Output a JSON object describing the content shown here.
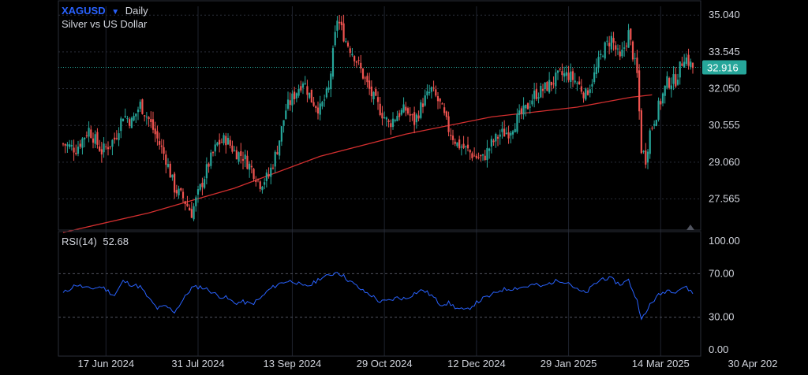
{
  "header": {
    "symbol": "XAGUSD",
    "symbol_dropdown_icon": "caret-down-icon",
    "interval": "Daily",
    "description": "Silver vs US Dollar"
  },
  "price_pane": {
    "y_ticks": [
      "35.040",
      "33.545",
      "32.050",
      "30.555",
      "29.060",
      "27.565"
    ],
    "last_price": "32.916",
    "colors": {
      "up": "#26a69a",
      "down": "#ef5350",
      "ma": "#d32f2f",
      "last_line": "#26a69a",
      "grid": "#2a2e39"
    }
  },
  "rsi_pane": {
    "label": "RSI(14)",
    "value": "52.68",
    "y_ticks": [
      "100.00",
      "70.00",
      "30.00",
      "0.00"
    ],
    "color": "#2962ff"
  },
  "x_axis": {
    "labels": [
      "17 Jun 2024",
      "31 Jul 2024",
      "13 Sep 2024",
      "29 Oct 2024",
      "12 Dec 2024",
      "29 Jan 2025",
      "14 Mar 2025",
      "30 Apr 202"
    ]
  },
  "chart_data": {
    "type": "candlestick",
    "symbol": "XAGUSD",
    "interval": "Daily",
    "y_range": [
      26.3,
      35.4
    ],
    "ma_series": [
      [
        0,
        26.2
      ],
      [
        40,
        27.0
      ],
      [
        80,
        28.0
      ],
      [
        120,
        29.3
      ],
      [
        160,
        30.2
      ],
      [
        200,
        30.9
      ],
      [
        240,
        31.3
      ],
      [
        265,
        31.7
      ],
      [
        275,
        31.8
      ]
    ],
    "close_series": [
      [
        0,
        29.8
      ],
      [
        6,
        29.6
      ],
      [
        12,
        30.4
      ],
      [
        18,
        29.5
      ],
      [
        24,
        30.0
      ],
      [
        28,
        31.0
      ],
      [
        32,
        30.7
      ],
      [
        36,
        31.4
      ],
      [
        40,
        30.8
      ],
      [
        44,
        30.0
      ],
      [
        48,
        29.2
      ],
      [
        52,
        28.0
      ],
      [
        56,
        27.6
      ],
      [
        60,
        27.0
      ],
      [
        64,
        28.0
      ],
      [
        68,
        29.0
      ],
      [
        72,
        29.8
      ],
      [
        76,
        30.0
      ],
      [
        80,
        29.5
      ],
      [
        84,
        29.3
      ],
      [
        88,
        28.8
      ],
      [
        92,
        28.2
      ],
      [
        96,
        28.5
      ],
      [
        100,
        29.6
      ],
      [
        104,
        31.2
      ],
      [
        108,
        31.8
      ],
      [
        112,
        32.4
      ],
      [
        116,
        31.6
      ],
      [
        120,
        31.2
      ],
      [
        124,
        32.0
      ],
      [
        128,
        34.9
      ],
      [
        132,
        34.0
      ],
      [
        136,
        33.4
      ],
      [
        140,
        32.6
      ],
      [
        144,
        31.8
      ],
      [
        148,
        31.2
      ],
      [
        152,
        30.6
      ],
      [
        156,
        31.0
      ],
      [
        160,
        31.2
      ],
      [
        164,
        30.7
      ],
      [
        168,
        31.5
      ],
      [
        172,
        32.0
      ],
      [
        176,
        31.4
      ],
      [
        180,
        30.4
      ],
      [
        184,
        29.8
      ],
      [
        188,
        29.6
      ],
      [
        192,
        29.3
      ],
      [
        196,
        29.2
      ],
      [
        200,
        29.8
      ],
      [
        204,
        30.2
      ],
      [
        208,
        30.3
      ],
      [
        212,
        30.8
      ],
      [
        216,
        31.2
      ],
      [
        220,
        31.8
      ],
      [
        224,
        32.0
      ],
      [
        228,
        32.3
      ],
      [
        232,
        32.6
      ],
      [
        236,
        32.6
      ],
      [
        240,
        32.3
      ],
      [
        244,
        31.8
      ],
      [
        248,
        32.6
      ],
      [
        252,
        33.6
      ],
      [
        256,
        34.1
      ],
      [
        260,
        33.2
      ],
      [
        264,
        34.3
      ],
      [
        268,
        32.6
      ],
      [
        270,
        29.6
      ],
      [
        272,
        29.2
      ],
      [
        274,
        30.3
      ],
      [
        278,
        31.3
      ],
      [
        282,
        32.3
      ],
      [
        286,
        32.4
      ],
      [
        290,
        33.4
      ],
      [
        294,
        32.9
      ]
    ],
    "rsi_series": [
      [
        0,
        52
      ],
      [
        6,
        60
      ],
      [
        12,
        56
      ],
      [
        18,
        58
      ],
      [
        24,
        50
      ],
      [
        28,
        63
      ],
      [
        32,
        60
      ],
      [
        36,
        58
      ],
      [
        40,
        47
      ],
      [
        44,
        38
      ],
      [
        48,
        40
      ],
      [
        52,
        35
      ],
      [
        56,
        46
      ],
      [
        60,
        57
      ],
      [
        64,
        58
      ],
      [
        68,
        55
      ],
      [
        72,
        50
      ],
      [
        76,
        48
      ],
      [
        80,
        43
      ],
      [
        84,
        44
      ],
      [
        88,
        42
      ],
      [
        92,
        47
      ],
      [
        96,
        55
      ],
      [
        100,
        60
      ],
      [
        104,
        63
      ],
      [
        108,
        63
      ],
      [
        112,
        58
      ],
      [
        116,
        60
      ],
      [
        120,
        66
      ],
      [
        124,
        68
      ],
      [
        128,
        72
      ],
      [
        132,
        66
      ],
      [
        136,
        60
      ],
      [
        140,
        54
      ],
      [
        144,
        50
      ],
      [
        148,
        44
      ],
      [
        152,
        45
      ],
      [
        156,
        48
      ],
      [
        160,
        47
      ],
      [
        164,
        52
      ],
      [
        168,
        55
      ],
      [
        172,
        50
      ],
      [
        176,
        42
      ],
      [
        180,
        43
      ],
      [
        184,
        38
      ],
      [
        188,
        36
      ],
      [
        192,
        42
      ],
      [
        196,
        47
      ],
      [
        200,
        50
      ],
      [
        204,
        55
      ],
      [
        208,
        56
      ],
      [
        212,
        57
      ],
      [
        216,
        58
      ],
      [
        220,
        60
      ],
      [
        224,
        58
      ],
      [
        228,
        62
      ],
      [
        232,
        64
      ],
      [
        236,
        62
      ],
      [
        240,
        55
      ],
      [
        244,
        52
      ],
      [
        248,
        60
      ],
      [
        252,
        66
      ],
      [
        256,
        65
      ],
      [
        260,
        60
      ],
      [
        264,
        64
      ],
      [
        268,
        45
      ],
      [
        270,
        30
      ],
      [
        272,
        32
      ],
      [
        274,
        42
      ],
      [
        278,
        50
      ],
      [
        282,
        55
      ],
      [
        286,
        54
      ],
      [
        290,
        58
      ],
      [
        294,
        53
      ]
    ]
  }
}
